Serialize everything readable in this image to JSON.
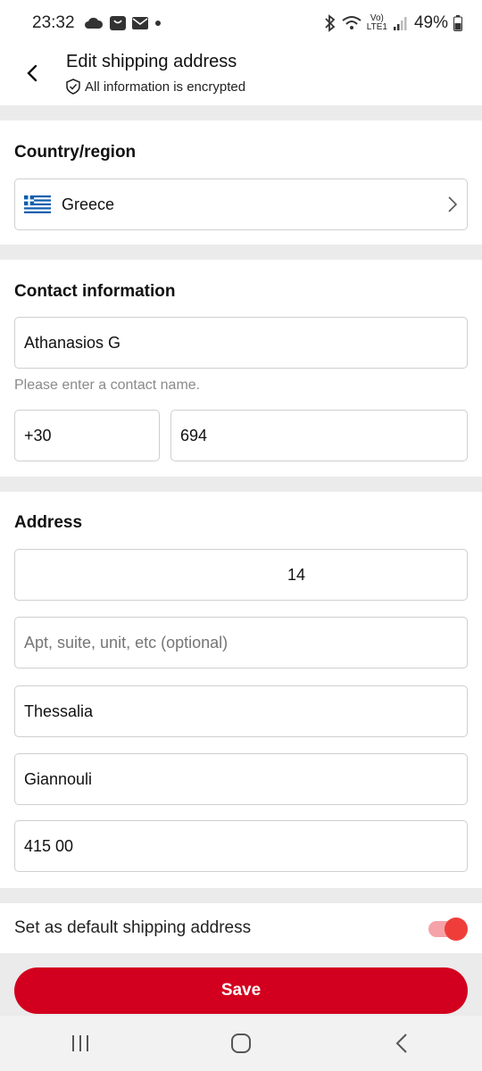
{
  "status_bar": {
    "time": "23:32",
    "battery": "49%",
    "network_label_top": "Vo)",
    "network_label_bottom": "LTE1"
  },
  "header": {
    "title": "Edit shipping address",
    "subtitle": "All information is encrypted"
  },
  "country_section": {
    "title": "Country/region",
    "country": "Greece"
  },
  "contact_section": {
    "title": "Contact information",
    "name_value": "Athanasios G",
    "name_hint": "Please enter a contact name.",
    "country_code": "+30",
    "phone_value": "694"
  },
  "address_section": {
    "title": "Address",
    "street_value": "14",
    "unit_placeholder": "Apt, suite, unit, etc (optional)",
    "state_value": "Thessalia",
    "city_value": "Giannouli",
    "postcode_value": "415 00"
  },
  "default_address": {
    "label": "Set as default shipping address",
    "enabled": true
  },
  "save_button": {
    "label": "Save"
  },
  "colors": {
    "accent": "#d2001e",
    "toggle_on": "#ef3e3a",
    "section_gap": "#ebebeb"
  },
  "icons": {
    "back": "chevron-left-icon",
    "encrypted": "shield-check-icon",
    "country_chevron": "chevron-right-icon",
    "nav_recents": "recent-apps-icon",
    "nav_home": "home-icon",
    "nav_back": "back-icon"
  }
}
